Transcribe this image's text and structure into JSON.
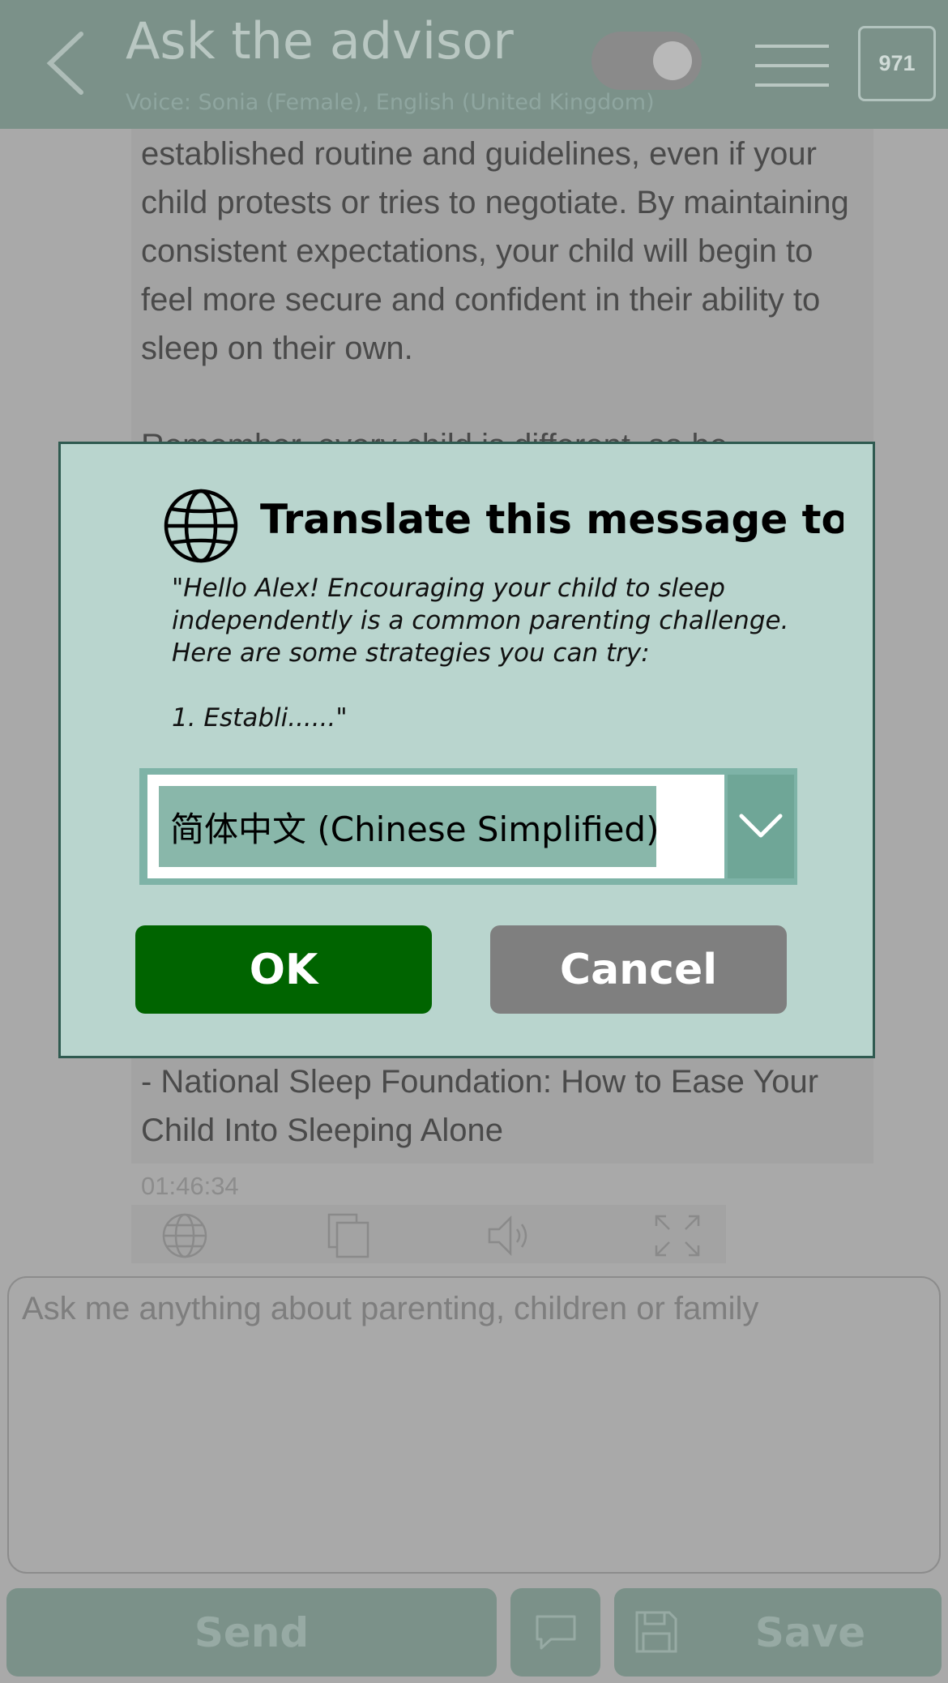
{
  "header": {
    "title": "Ask the advisor",
    "voice": "Voice: Sonia (Female), English (United Kingdom)",
    "counter": "971"
  },
  "message": {
    "paragraph": "established routine and guidelines, even if your child protests or tries to negotiate. By maintaining consistent expectations, your child will begin to feel more secure and confident in their ability to sleep on their own.",
    "partial_line": "Remember, every child is different, so be",
    "source": "- National Sleep Foundation: How to Ease Your Child Into Sleeping Alone",
    "timestamp": "01:46:34"
  },
  "input": {
    "placeholder": "Ask me anything about parenting, children or family"
  },
  "bottom_bar": {
    "send_label": "Send",
    "save_label": "Save"
  },
  "modal": {
    "title": "Translate this message to",
    "quote": "\"Hello Alex! Encouraging your child to sleep independently is a common parenting challenge. Here are some strategies you can try:\n\n1. Establi......\"",
    "selected_language": "简体中文 (Chinese Simplified)",
    "ok_label": "OK",
    "cancel_label": "Cancel"
  }
}
